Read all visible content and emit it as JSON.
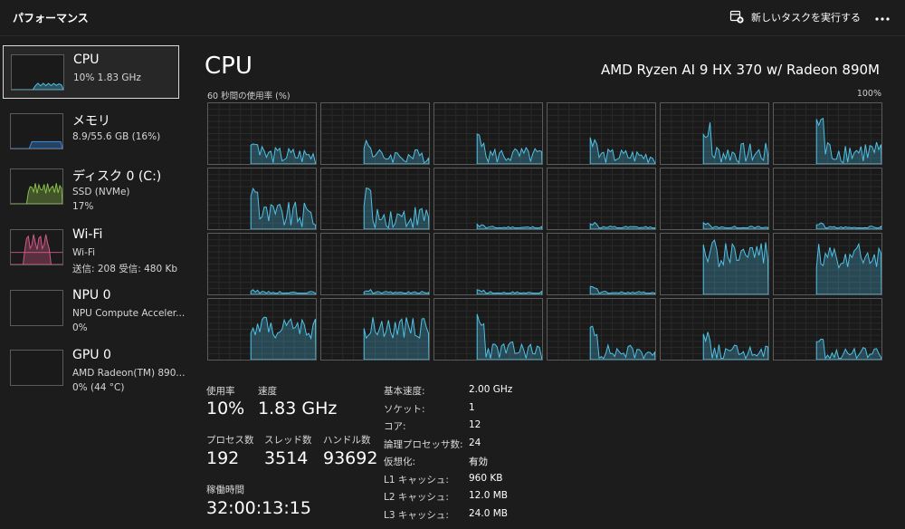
{
  "header": {
    "title": "パフォーマンス",
    "new_task_label": "新しいタスクを実行する",
    "new_task_icon": "new-task-icon",
    "more_icon": "more-options-icon"
  },
  "sidebar": {
    "items": [
      {
        "name": "CPU",
        "lines": [
          "10%  1.83 GHz"
        ],
        "active": true,
        "color": "#4fc3e8"
      },
      {
        "name": "メモリ",
        "lines": [
          "8.9/55.6 GB (16%)"
        ],
        "active": false,
        "color": "#3f8fe0"
      },
      {
        "name": "ディスク 0 (C:)",
        "lines": [
          "SSD (NVMe)",
          "17%"
        ],
        "active": false,
        "color": "#8bc34a"
      },
      {
        "name": "Wi-Fi",
        "lines": [
          "Wi-Fi",
          "送信: 208  受信: 480 Kb"
        ],
        "active": false,
        "color": "#d35b8a"
      },
      {
        "name": "NPU 0",
        "lines": [
          "NPU Compute Acceler...",
          "0%"
        ],
        "active": false,
        "color": "#4fc3e8"
      },
      {
        "name": "GPU 0",
        "lines": [
          "AMD Radeon(TM) 890...",
          "0% (44 °C)"
        ],
        "active": false,
        "color": "#4fc3e8"
      }
    ]
  },
  "main": {
    "title": "CPU",
    "model": "AMD Ryzen AI 9 HX 370 w/ Radeon 890M",
    "graph_label": "60 秒間の使用率 (%)",
    "graph_max": "100%",
    "graph_color": "#4fc3e8"
  },
  "stats": {
    "utilization_label": "使用率",
    "utilization": "10%",
    "speed_label": "速度",
    "speed": "1.83 GHz",
    "processes_label": "プロセス数",
    "processes": "192",
    "threads_label": "スレッド数",
    "threads": "3514",
    "handles_label": "ハンドル数",
    "handles": "93692",
    "uptime_label": "稼働時間",
    "uptime": "32:00:13:15"
  },
  "details": [
    {
      "key": "基本速度:",
      "value": "2.00 GHz"
    },
    {
      "key": "ソケット:",
      "value": "1"
    },
    {
      "key": "コア:",
      "value": "12"
    },
    {
      "key": "論理プロセッサ数:",
      "value": "24"
    },
    {
      "key": "仮想化:",
      "value": "有効"
    },
    {
      "key": "L1 キャッシュ:",
      "value": "960 KB"
    },
    {
      "key": "L2 キャッシュ:",
      "value": "12.0 MB"
    },
    {
      "key": "L3 キャッシュ:",
      "value": "24.0 MB"
    }
  ]
}
